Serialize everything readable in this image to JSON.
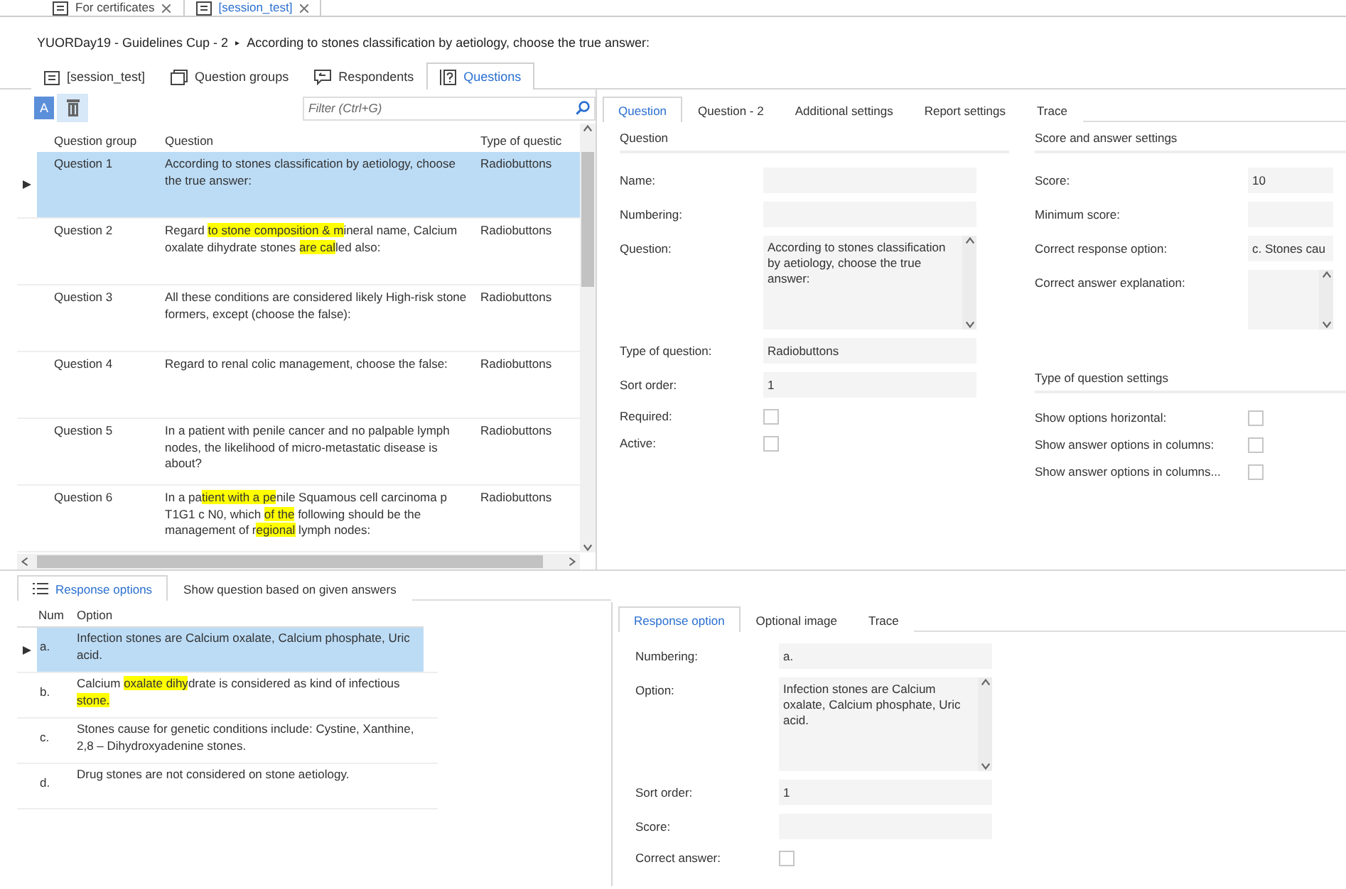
{
  "document_tabs": [
    {
      "label": "For certificates",
      "selected": false
    },
    {
      "label": "[session_test]",
      "selected": true
    }
  ],
  "breadcrumb": {
    "path": "YUORDay19 - Guidelines Cup - 2",
    "separator": "▸",
    "current": "According to stones classification by aetiology, choose the true answer:"
  },
  "section_tabs": [
    {
      "label": "[session_test]",
      "selected": false
    },
    {
      "label": "Question groups",
      "selected": false
    },
    {
      "label": "Respondents",
      "selected": false
    },
    {
      "label": "Questions",
      "selected": true
    }
  ],
  "toolbar": {
    "font_button": "A",
    "filter": {
      "placeholder": "Filter (Ctrl+G)"
    }
  },
  "questions_table": {
    "columns": [
      "Question group",
      "Question",
      "Type of questic"
    ],
    "rows": [
      {
        "group": "Question 1",
        "question": [
          {
            "text": "According to stones classification by aetiology, choose the true answer:",
            "highlighted": false
          }
        ],
        "type": "Radiobuttons",
        "selected": true
      },
      {
        "group": "Question 2",
        "question": [
          {
            "text": "Regard ",
            "highlighted": false
          },
          {
            "text": "to stone composition & m",
            "highlighted": true
          },
          {
            "text": "ineral name, Calcium oxalate dihydrate stones ",
            "highlighted": false
          },
          {
            "text": "are cal",
            "highlighted": true
          },
          {
            "text": "led also:",
            "highlighted": false
          }
        ],
        "type": "Radiobuttons",
        "selected": false
      },
      {
        "group": "Question 3",
        "question": [
          {
            "text": "All these conditions are considered likely High-risk stone formers, except (choose the false):",
            "highlighted": false
          }
        ],
        "type": "Radiobuttons",
        "selected": false
      },
      {
        "group": "Question 4",
        "question": [
          {
            "text": "Regard to renal colic management, choose the false:",
            "highlighted": false
          }
        ],
        "type": "Radiobuttons",
        "selected": false
      },
      {
        "group": "Question 5",
        "question": [
          {
            "text": "In a patient with penile cancer and no palpable lymph nodes, the likelihood of micro-metastatic disease is about?",
            "highlighted": false
          }
        ],
        "type": "Radiobuttons",
        "selected": false
      },
      {
        "group": "Question 6",
        "question": [
          {
            "text": "In a pa",
            "highlighted": false
          },
          {
            "text": "tient with a pe",
            "highlighted": true
          },
          {
            "text": "nile Squamous cell carcinoma p T1G1 c N0, which ",
            "highlighted": false
          },
          {
            "text": "of the",
            "highlighted": true
          },
          {
            "text": " following should be the management of r",
            "highlighted": false
          },
          {
            "text": "egional",
            "highlighted": true
          },
          {
            "text": " lymph nodes:",
            "highlighted": false
          }
        ],
        "type": "Radiobuttons",
        "selected": false
      }
    ]
  },
  "detail_tabs": [
    {
      "label": "Question",
      "selected": true
    },
    {
      "label": "Question - 2",
      "selected": false
    },
    {
      "label": "Additional settings",
      "selected": false
    },
    {
      "label": "Report settings",
      "selected": false
    },
    {
      "label": "Trace",
      "selected": false
    }
  ],
  "question_section": {
    "title": "Question",
    "fields": [
      {
        "kind": "text",
        "label": "Name:"
      },
      {
        "kind": "text",
        "label": "Numbering:"
      },
      {
        "kind": "textarea",
        "label": "Question:",
        "value": "According to stones classification by aetiology, choose the true answer:"
      },
      {
        "kind": "text",
        "label": "Type of question:",
        "value": "Radiobuttons"
      },
      {
        "kind": "text",
        "label": "Sort order:",
        "value": "1"
      },
      {
        "kind": "checkbox",
        "label": "Required:",
        "checked": false
      },
      {
        "kind": "checkbox",
        "label": "Active:",
        "checked": false
      }
    ]
  },
  "score_section": {
    "title": "Score and answer settings",
    "fields": [
      {
        "kind": "text",
        "label": "Score:",
        "value": "10"
      },
      {
        "kind": "text",
        "label": "Minimum score:"
      },
      {
        "kind": "text",
        "label": "Correct response option:",
        "value": "c. Stones cau"
      },
      {
        "kind": "textarea",
        "label": "Correct answer explanation:"
      }
    ]
  },
  "type_settings_section": {
    "title": "Type of question settings",
    "fields": [
      {
        "kind": "checkbox",
        "label": "Show options horizontal:",
        "checked": false
      },
      {
        "kind": "checkbox",
        "label": "Show answer options in columns:",
        "checked": false
      },
      {
        "kind": "checkbox",
        "label": "Show answer options in columns...",
        "checked": false
      }
    ]
  },
  "bottom_tabs": [
    {
      "label": "Response options",
      "selected": true
    },
    {
      "label": "Show question based on given answers",
      "selected": false
    }
  ],
  "options_table": {
    "columns": [
      "Num",
      "Option"
    ],
    "rows": [
      {
        "num": "a.",
        "option": [
          {
            "text": "Infection stones are Calcium oxalate, Calcium phosphate, Uric acid.",
            "highlighted": false
          }
        ],
        "selected": true
      },
      {
        "num": "b.",
        "option": [
          {
            "text": "Calcium ",
            "highlighted": false
          },
          {
            "text": "oxalate dihy",
            "highlighted": true
          },
          {
            "text": "drate is considered as kind of infectious ",
            "highlighted": false
          },
          {
            "text": "stone.",
            "highlighted": true
          }
        ],
        "selected": false
      },
      {
        "num": "c.",
        "option": [
          {
            "text": "Stones cause for genetic conditions include: Cystine, Xanthine, 2,8 – Dihydroxyadenine stones.",
            "highlighted": false
          }
        ],
        "selected": false
      },
      {
        "num": "d.",
        "option": [
          {
            "text": "Drug stones are not considered on stone aetiology.",
            "highlighted": false
          }
        ],
        "selected": false
      }
    ]
  },
  "response_tabs": [
    {
      "label": "Response option",
      "selected": true
    },
    {
      "label": "Optional image",
      "selected": false
    },
    {
      "label": "Trace",
      "selected": false
    }
  ],
  "response_section": {
    "fields": [
      {
        "kind": "text",
        "label": "Numbering:",
        "value": "a."
      },
      {
        "kind": "textarea",
        "label": "Option:",
        "value": "Infection stones are Calcium oxalate, Calcium phosphate, Uric acid."
      },
      {
        "kind": "text",
        "label": "Sort order:",
        "value": "1"
      },
      {
        "kind": "text",
        "label": "Score:"
      },
      {
        "kind": "checkbox",
        "label": "Correct answer:",
        "checked": false
      }
    ]
  }
}
